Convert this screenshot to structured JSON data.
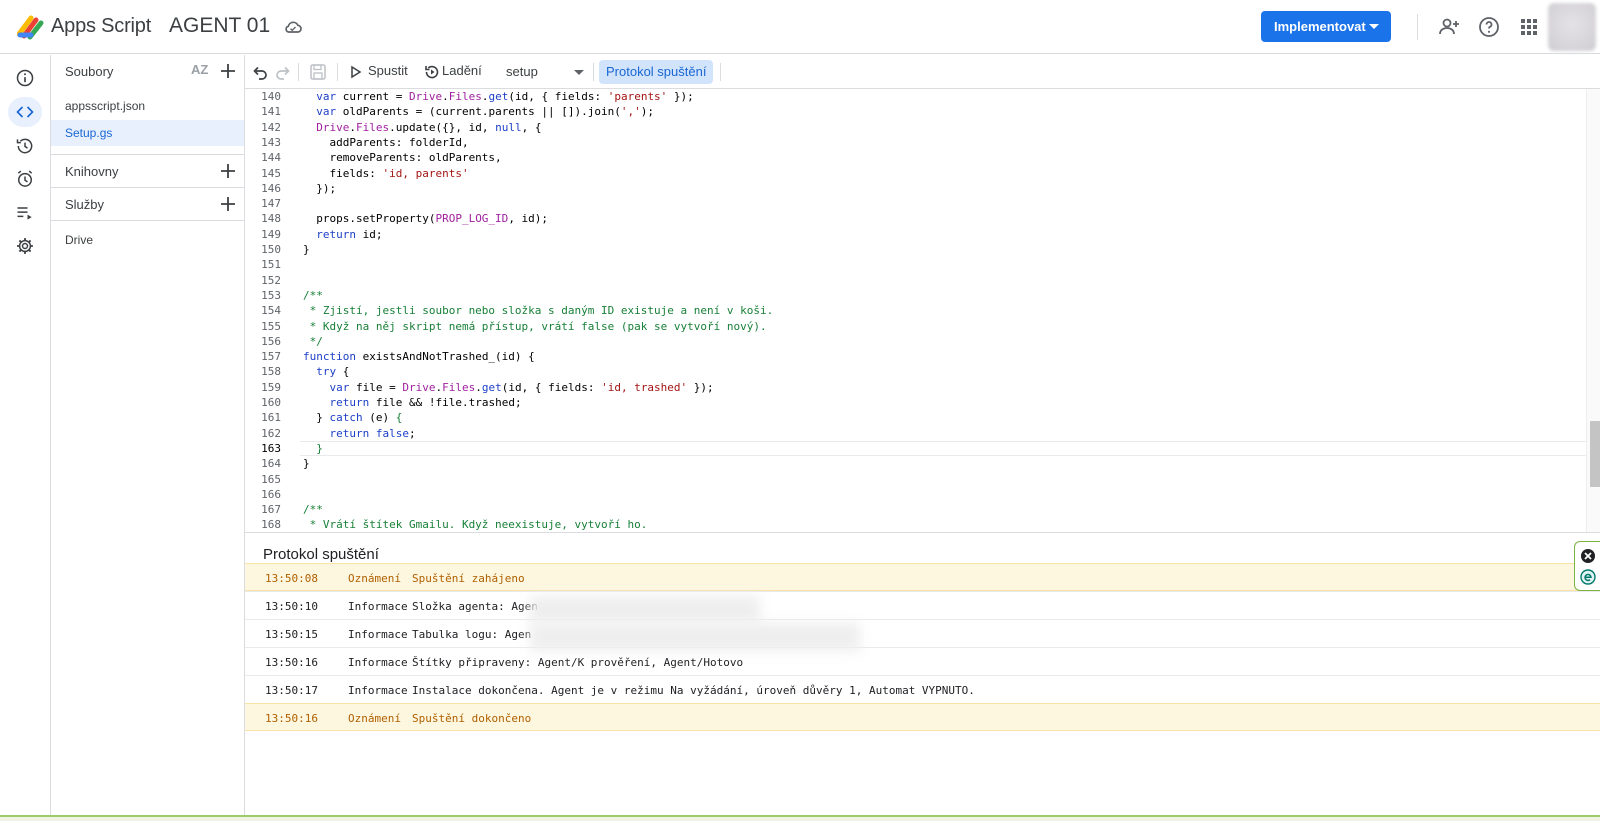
{
  "header": {
    "app_name": "Apps Script",
    "project_title": "AGENT 01",
    "deploy_label": "Implementovat",
    "icons": [
      "apps-script-logo",
      "cloud-icon",
      "add-person-icon",
      "help-icon",
      "apps-grid-icon",
      "avatar"
    ]
  },
  "rail": {
    "items": [
      "info-icon",
      "code-icon",
      "history-icon",
      "alarm-icon",
      "executions-icon",
      "settings-icon"
    ],
    "active": "code-icon"
  },
  "files_panel": {
    "files_header": "Soubory",
    "sort_label": "AZ",
    "files": [
      {
        "name": "appsscript.json",
        "active": false
      },
      {
        "name": "Setup.gs",
        "active": true
      }
    ],
    "libraries_header": "Knihovny",
    "services_header": "Služby",
    "services": [
      "Drive"
    ]
  },
  "toolbar": {
    "run_label": "Spustit",
    "debug_label": "Ladění",
    "function_selected": "setup",
    "log_toggle_label": "Protokol spuštění"
  },
  "editor": {
    "current_line": "163",
    "lines": [
      {
        "n": "140",
        "html": "  <span class='k'>var</span> current = <span class='g'>Drive</span>.<span class='g'>Files</span>.<span class='k'>get</span>(id, { fields: <span class='s'>'parents'</span> });"
      },
      {
        "n": "141",
        "html": "  <span class='k'>var</span> oldParents = (current.parents || []).join(<span class='s'>','</span>);"
      },
      {
        "n": "142",
        "html": "  <span class='g'>Drive</span>.<span class='g'>Files</span>.update({}, id, <span class='k'>null</span>, {"
      },
      {
        "n": "143",
        "html": "    addParents: folderId,"
      },
      {
        "n": "144",
        "html": "    removeParents: oldParents,"
      },
      {
        "n": "145",
        "html": "    fields: <span class='s'>'id, parents'</span>"
      },
      {
        "n": "146",
        "html": "  });"
      },
      {
        "n": "147",
        "html": ""
      },
      {
        "n": "148",
        "html": "  props.setProperty(<span class='g'>PROP_LOG_ID</span>, id);"
      },
      {
        "n": "149",
        "html": "  <span class='k'>return</span> id;"
      },
      {
        "n": "150",
        "html": "}"
      },
      {
        "n": "151",
        "html": ""
      },
      {
        "n": "152",
        "html": ""
      },
      {
        "n": "153",
        "html": "<span class='c'>/**</span>"
      },
      {
        "n": "154",
        "html": "<span class='c'> * Zjistí, jestli soubor nebo složka s daným ID existuje a není v koši.</span>"
      },
      {
        "n": "155",
        "html": "<span class='c'> * Když na něj skript nemá přístup, vrátí false (pak se vytvoří nový).</span>"
      },
      {
        "n": "156",
        "html": "<span class='c'> */</span>"
      },
      {
        "n": "157",
        "html": "<span class='k'>function</span> existsAndNotTrashed_(id) {"
      },
      {
        "n": "158",
        "html": "  <span class='k'>try</span> {"
      },
      {
        "n": "159",
        "html": "    <span class='k'>var</span> file = <span class='g'>Drive</span>.<span class='g'>Files</span>.<span class='k'>get</span>(id, { fields: <span class='s'>'id, trashed'</span> });"
      },
      {
        "n": "160",
        "html": "    <span class='k'>return</span> file &amp;&amp; !file.trashed;"
      },
      {
        "n": "161",
        "html": "  } <span class='k'>catch</span> (e) <span class='c'>{</span>"
      },
      {
        "n": "162",
        "html": "    <span class='k'>return</span> <span class='k'>false</span>;"
      },
      {
        "n": "163",
        "html": "  <span class='c'>}</span>"
      },
      {
        "n": "164",
        "html": "}"
      },
      {
        "n": "165",
        "html": ""
      },
      {
        "n": "166",
        "html": ""
      },
      {
        "n": "167",
        "html": "<span class='c'>/**</span>"
      },
      {
        "n": "168",
        "html": "<span class='c'> * Vrátí štítek Gmailu. Když neexistuje, vytvoří ho.</span>"
      }
    ]
  },
  "log": {
    "title": "Protokol spuštění",
    "rows": [
      {
        "time": "13:50:08",
        "level": "Oznámení",
        "message": "Spuštění zahájeno",
        "notice": true
      },
      {
        "time": "13:50:10",
        "level": "Informace",
        "message": "Složka agenta: Agen",
        "notice": false
      },
      {
        "time": "13:50:15",
        "level": "Informace",
        "message": "Tabulka logu: Agen",
        "notice": false
      },
      {
        "time": "13:50:16",
        "level": "Informace",
        "message": "Štítky připraveny: Agent/K prověření, Agent/Hotovo",
        "notice": false
      },
      {
        "time": "13:50:17",
        "level": "Informace",
        "message": "Instalace dokončena. Agent je v režimu Na vyžádání, úroveň důvěry 1, Automat VYPNUTO.",
        "notice": false
      },
      {
        "time": "13:50:16",
        "level": "Oznámení",
        "message": "Spuštění dokončeno",
        "notice": true
      }
    ]
  },
  "colors": {
    "accent": "#1a73e8",
    "notice_bg": "#fef7e0",
    "notice_text": "#b06000"
  }
}
